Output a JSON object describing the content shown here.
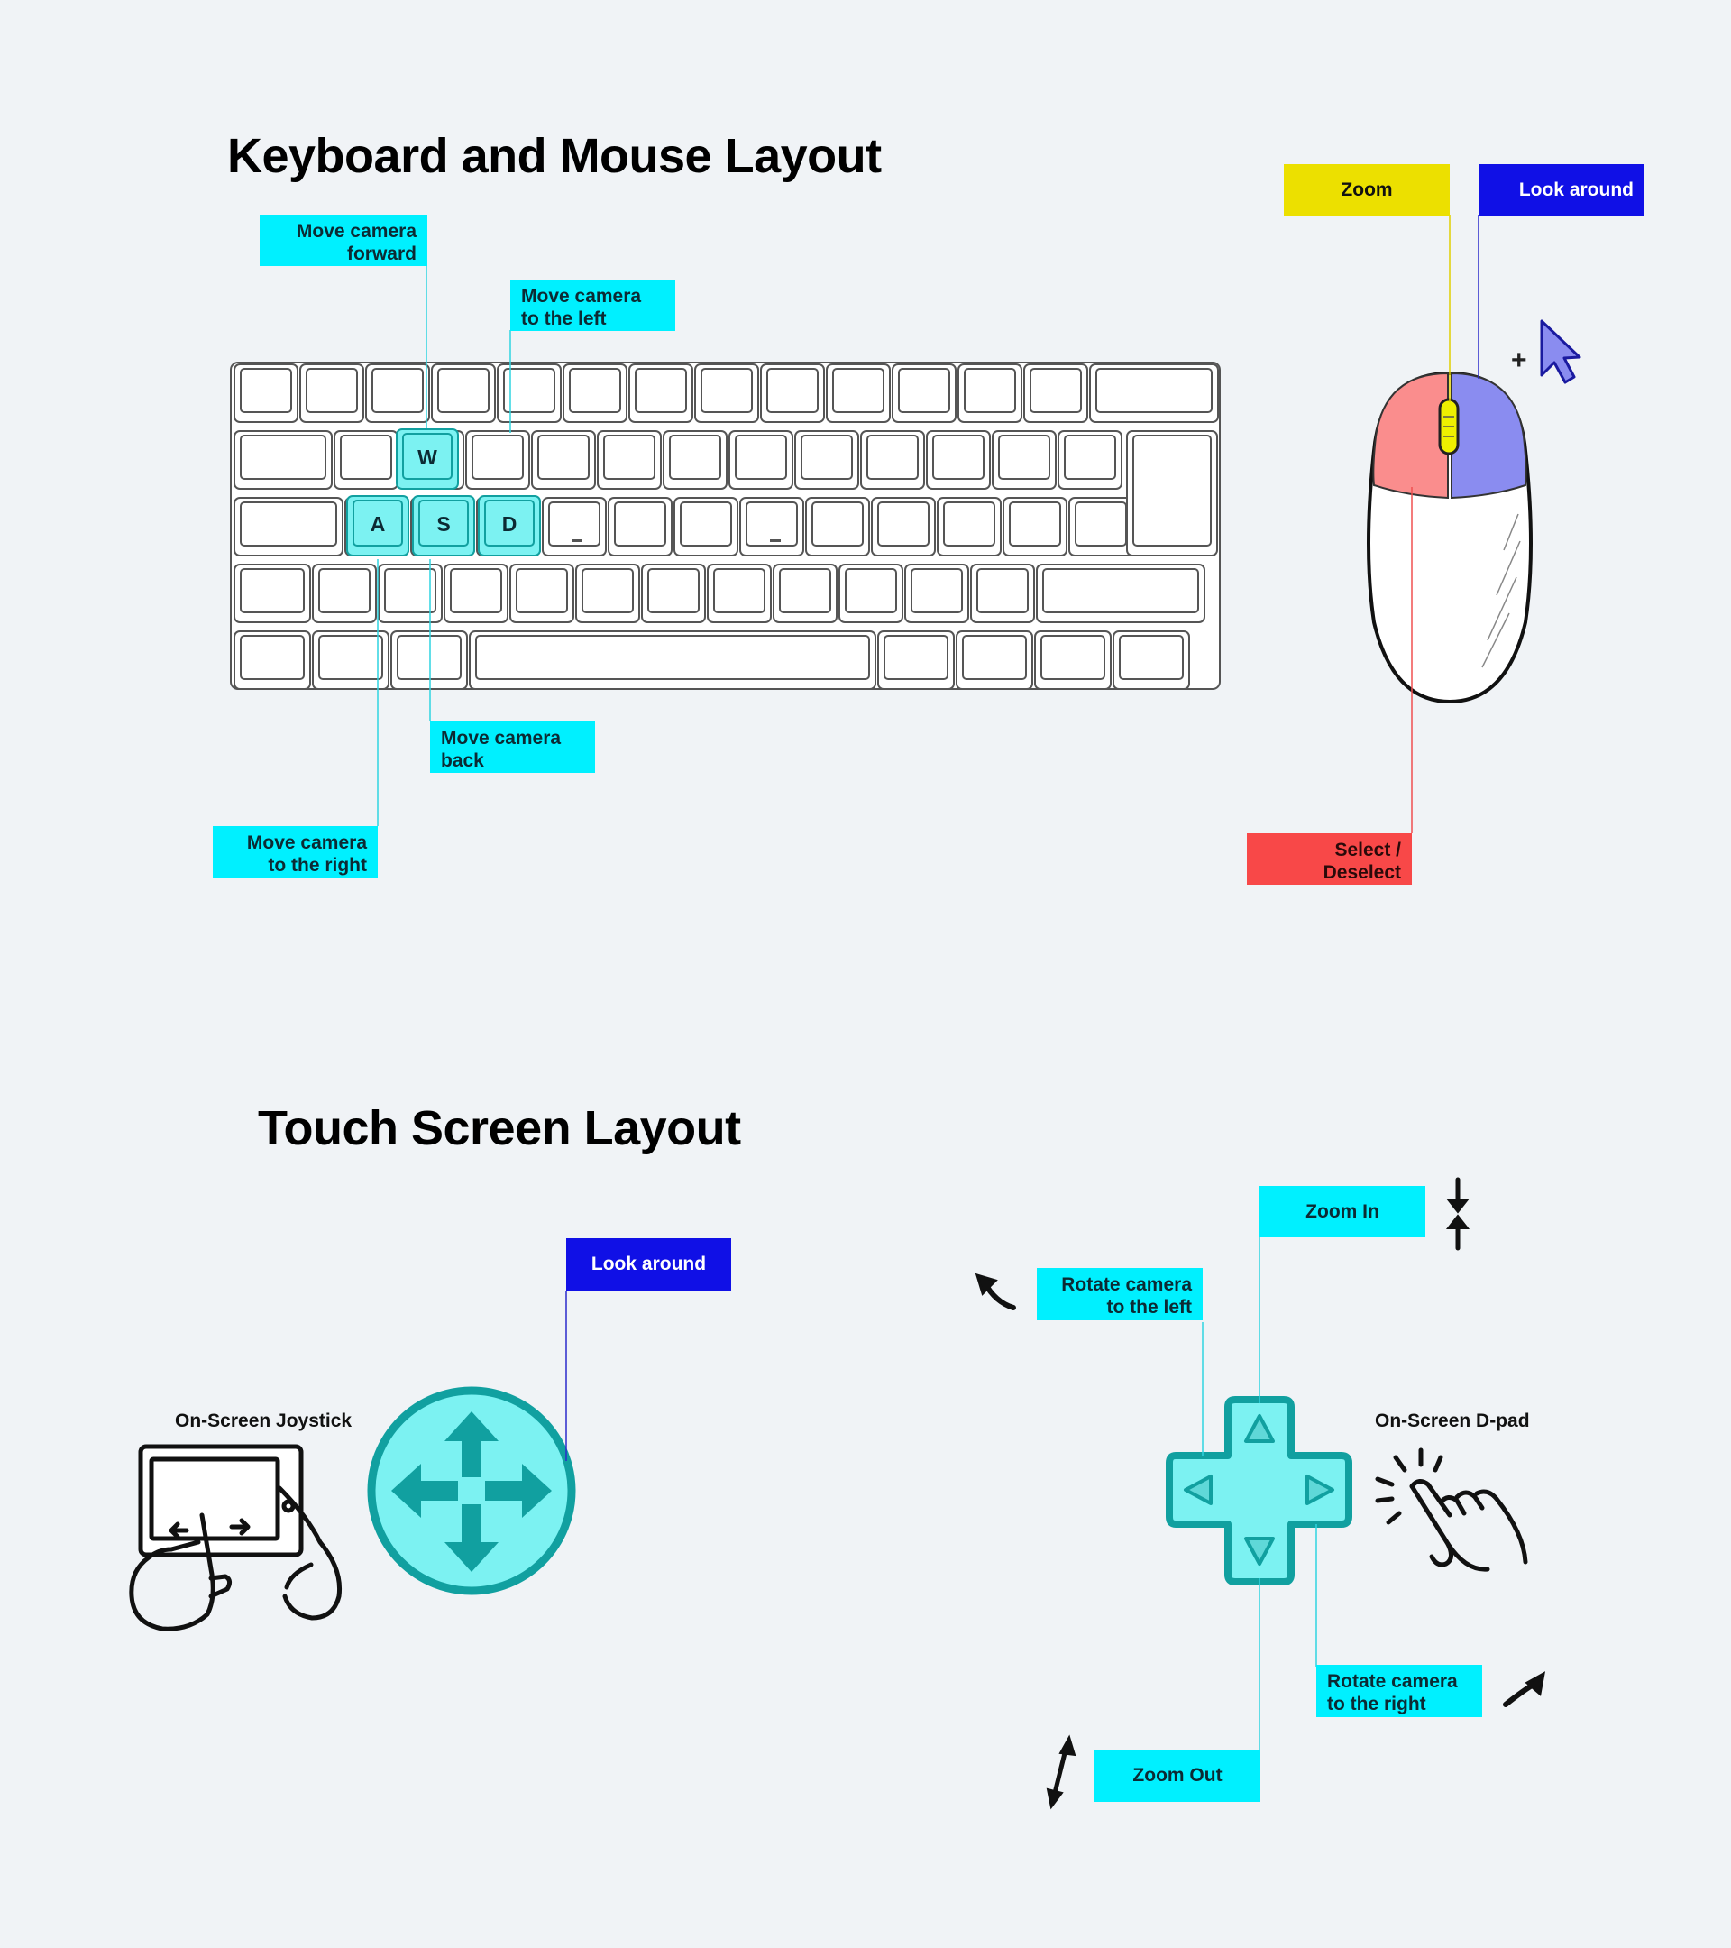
{
  "headings": {
    "keyboard_mouse": "Keyboard and Mouse Layout",
    "touch": "Touch Screen Layout"
  },
  "keyboard": {
    "keys": {
      "w": "W",
      "a": "A",
      "s": "S",
      "d": "D"
    },
    "callouts": {
      "forward": "Move camera\nforward",
      "left": "Move camera\nto the left",
      "back": "Move camera\nback",
      "right": "Move camera\nto the right"
    }
  },
  "mouse": {
    "callouts": {
      "zoom": "Zoom",
      "look": "Look around",
      "select": "Select /\nDeselect"
    },
    "plus_symbol": "+"
  },
  "touch": {
    "joystick_caption": "On-Screen Joystick",
    "dpad_caption": "On-Screen D-pad",
    "callouts": {
      "look": "Look around",
      "zoom_in": "Zoom In",
      "rotate_left": "Rotate camera\nto the left",
      "rotate_right": "Rotate camera\nto the right",
      "zoom_out": "Zoom Out"
    }
  },
  "colors": {
    "cyan": "#00f0ff",
    "blue": "#1010e6",
    "yellow": "#ece000",
    "red": "#f84848",
    "mouse_left": "#fa8d8d",
    "mouse_right": "#8a8cf0",
    "touch_fill": "#7cf2f2",
    "touch_stroke": "#11a0a0"
  }
}
